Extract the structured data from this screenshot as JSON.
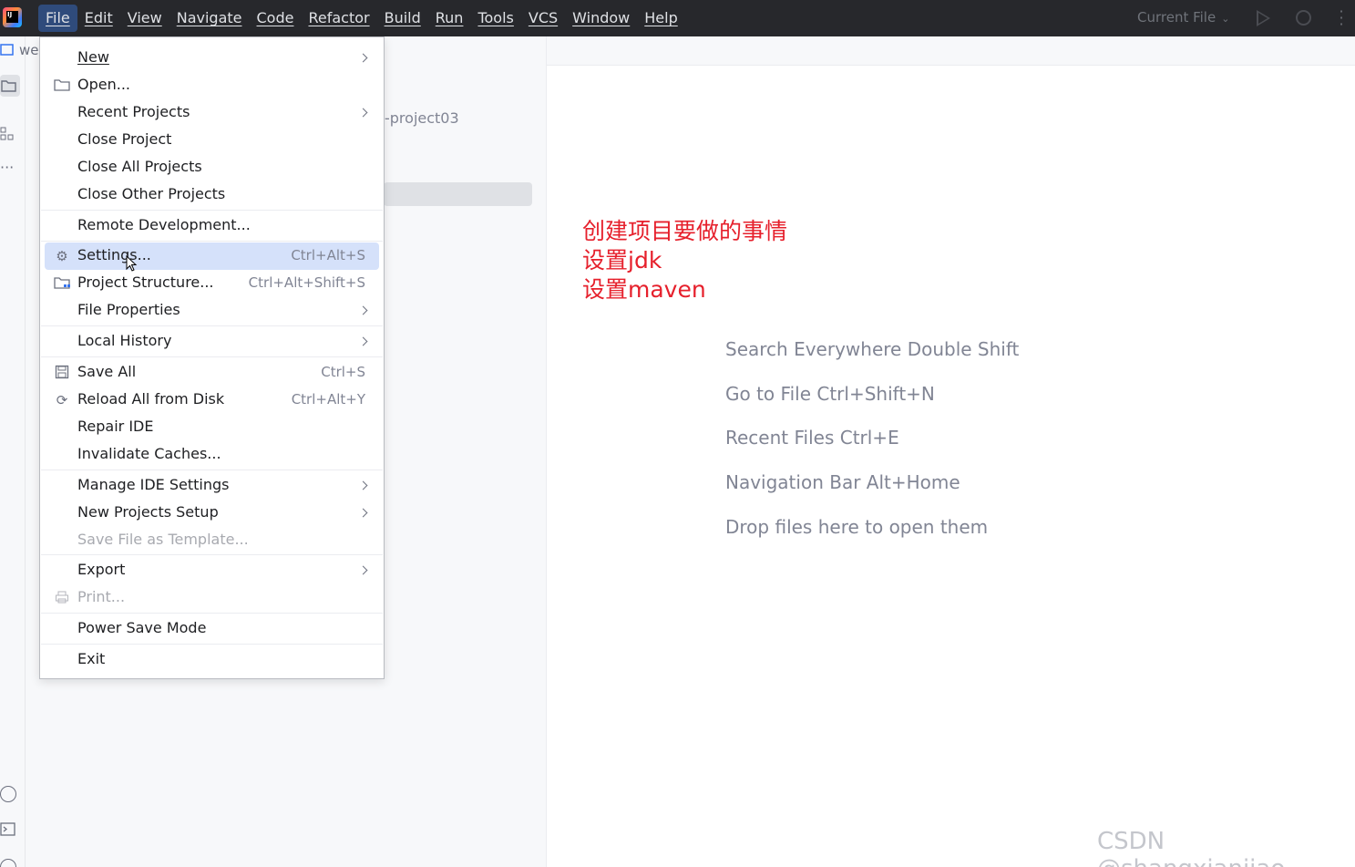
{
  "menubar": {
    "items": [
      {
        "label": "File",
        "active": true
      },
      {
        "label": "Edit"
      },
      {
        "label": "View"
      },
      {
        "label": "Navigate"
      },
      {
        "label": "Code"
      },
      {
        "label": "Refactor"
      },
      {
        "label": "Build"
      },
      {
        "label": "Run"
      },
      {
        "label": "Tools"
      },
      {
        "label": "VCS"
      },
      {
        "label": "Window"
      },
      {
        "label": "Help"
      }
    ]
  },
  "toolbar": {
    "run_config": "Current File",
    "run_icon": "play-icon",
    "debug_icon": "bug-icon",
    "more_icon": "more-vertical-icon"
  },
  "project_panel": {
    "title_fragment": "we",
    "project_name_fragment": "-project03"
  },
  "file_menu": {
    "items": [
      {
        "label": "New",
        "submenu": true
      },
      {
        "label": "Open...",
        "icon": "folder-icon"
      },
      {
        "label": "Recent Projects",
        "submenu": true
      },
      {
        "label": "Close Project"
      },
      {
        "label": "Close All Projects"
      },
      {
        "label": "Close Other Projects"
      },
      {
        "label": "Remote Development..."
      },
      {
        "label": "Settings...",
        "shortcut": "Ctrl+Alt+S",
        "icon": "gear-icon",
        "highlighted": true
      },
      {
        "label": "Project Structure...",
        "shortcut": "Ctrl+Alt+Shift+S",
        "icon": "project-structure-icon"
      },
      {
        "label": "File Properties",
        "submenu": true
      },
      {
        "label": "Local History",
        "submenu": true
      },
      {
        "label": "Save All",
        "shortcut": "Ctrl+S",
        "icon": "save-icon"
      },
      {
        "label": "Reload All from Disk",
        "shortcut": "Ctrl+Alt+Y",
        "icon": "reload-icon"
      },
      {
        "label": "Repair IDE"
      },
      {
        "label": "Invalidate Caches..."
      },
      {
        "label": "Manage IDE Settings",
        "submenu": true
      },
      {
        "label": "New Projects Setup",
        "submenu": true
      },
      {
        "label": "Save File as Template...",
        "disabled": true
      },
      {
        "label": "Export",
        "submenu": true
      },
      {
        "label": "Print...",
        "disabled": true,
        "icon": "printer-icon"
      },
      {
        "label": "Power Save Mode"
      },
      {
        "label": "Exit"
      }
    ]
  },
  "annotation": {
    "line1": "创建项目要做的事情",
    "line2": "设置jdk",
    "line3": "设置maven",
    "color": "#e6202c"
  },
  "editor_hints": [
    "Search Everywhere Double Shift",
    "Go to File Ctrl+Shift+N",
    "Recent Files Ctrl+E",
    "Navigation Bar Alt+Home",
    "Drop files here to open them"
  ],
  "watermark": "CSDN @shangxianjiao",
  "colors": {
    "topbar": "#27282c",
    "menu_highlight": "#d5e1fa",
    "active_menu": "#2f4b7b"
  }
}
